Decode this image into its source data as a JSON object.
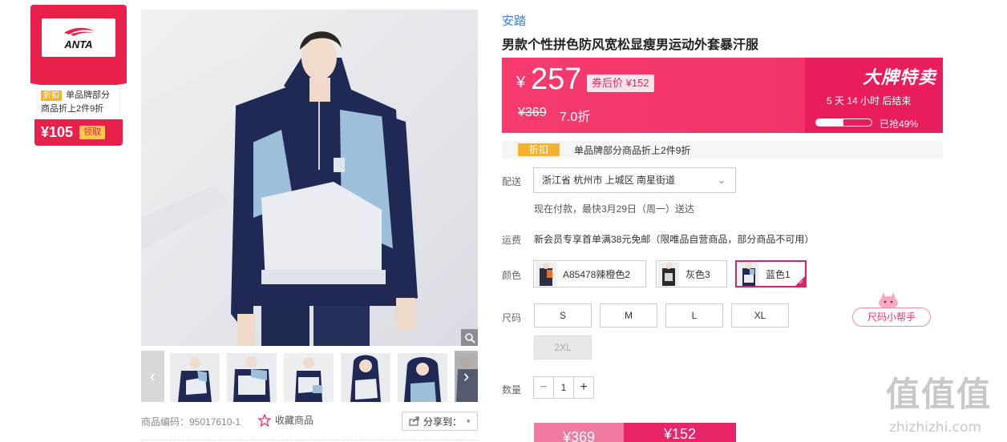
{
  "coupon": {
    "logo_text": "ANTA",
    "tag": "折扣",
    "desc": "单品牌部分商品折上2件9折",
    "price": "¥105",
    "get_label": "领取"
  },
  "gallery": {
    "product_code": "商品编码：95017610-1",
    "favorite_label": "收藏商品",
    "share_label": "分享到："
  },
  "product": {
    "brand": "安踏",
    "title": "男款个性拼色防风宽松显瘦男运动外套暴汗服"
  },
  "price": {
    "currency": "¥",
    "current": "257",
    "after_coupon": "券后价 ¥152",
    "original": "¥369",
    "discount": "7.0折"
  },
  "flash": {
    "title": "大牌特卖",
    "countdown": "5  天  14  小时  后结束",
    "sold_fraction": 0.49,
    "sold_label": "已抢49%"
  },
  "promo": {
    "tag": "折扣",
    "text": "单品牌部分商品折上2件9折"
  },
  "delivery": {
    "label": "配送",
    "address": "浙江省 杭州市 上城区 南星街道",
    "eta": "现在付款，最快3月29日（周一）送达"
  },
  "shipping": {
    "label": "运费",
    "text": "新会员专享首单满38元免邮（限唯品自营商品，部分商品不可用）"
  },
  "colors": {
    "label": "颜色",
    "options": [
      "A85478辣橙色2",
      "灰色3",
      "蓝色1"
    ]
  },
  "sizes": {
    "label": "尺码",
    "options": [
      "S",
      "M",
      "L",
      "XL",
      "2XL"
    ],
    "helper": "尺码小帮手"
  },
  "quantity": {
    "label": "数量",
    "value": "1",
    "minus": "−",
    "plus": "+"
  },
  "buy": {
    "original_price": "¥369",
    "coupon_price": "¥152"
  },
  "watermark": {
    "chars": "值值值",
    "url": "zhizhizhi.com"
  },
  "theme": {
    "accent": "#e8214a",
    "price_pink": "#f63b6e",
    "brand_blue": "#3f7dd1"
  }
}
